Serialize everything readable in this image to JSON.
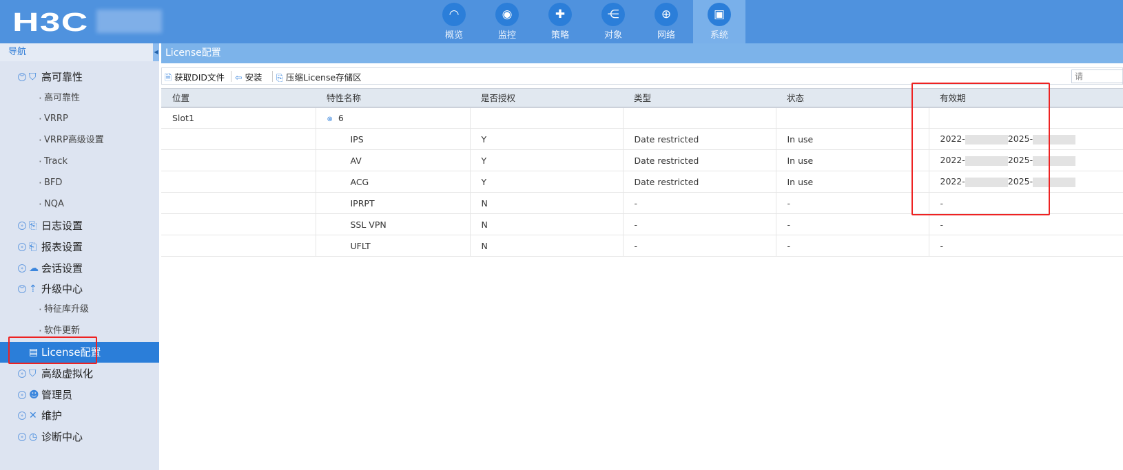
{
  "header": {
    "logo": "H3C",
    "tabs": [
      {
        "label": "概览",
        "icon": "gauge-icon",
        "glyph": "◠"
      },
      {
        "label": "监控",
        "icon": "webcam-icon",
        "glyph": "◉"
      },
      {
        "label": "策略",
        "icon": "shield-icon",
        "glyph": "✚"
      },
      {
        "label": "对象",
        "icon": "share-icon",
        "glyph": "⋲"
      },
      {
        "label": "网络",
        "icon": "globe-icon",
        "glyph": "⊕"
      },
      {
        "label": "系统",
        "icon": "monitor-icon",
        "glyph": "▣"
      }
    ],
    "active": "系统"
  },
  "sidebar": {
    "title": "导航",
    "items": [
      {
        "label": "高可靠性",
        "icon": "⛉"
      },
      {
        "label": "高可靠性"
      },
      {
        "label": "VRRP"
      },
      {
        "label": "VRRP高级设置"
      },
      {
        "label": "Track"
      },
      {
        "label": "BFD"
      },
      {
        "label": "NQA"
      },
      {
        "label": "日志设置",
        "icon": "⎘"
      },
      {
        "label": "报表设置",
        "icon": "⎗"
      },
      {
        "label": "会话设置",
        "icon": "☁"
      },
      {
        "label": "升级中心",
        "icon": "⇡"
      },
      {
        "label": "特征库升级"
      },
      {
        "label": "软件更新"
      },
      {
        "label": "License配置",
        "icon": "▤"
      },
      {
        "label": "高级虚拟化",
        "icon": "⛉"
      },
      {
        "label": "管理员",
        "icon": "☻"
      },
      {
        "label": "维护",
        "icon": "✕"
      },
      {
        "label": "诊断中心",
        "icon": "◷"
      }
    ]
  },
  "page": {
    "title": "License配置"
  },
  "toolbar": {
    "get_did": "获取DID文件",
    "install": "安装",
    "compress": "压缩License存储区",
    "search_placeholder": "请"
  },
  "table": {
    "headers": [
      "位置",
      "特性名称",
      "是否授权",
      "类型",
      "状态",
      "有效期"
    ],
    "group": {
      "slot": "Slot1",
      "count": "6"
    },
    "rows": [
      {
        "name": "IPS",
        "auth": "Y",
        "type": "Date restricted",
        "status": "In use",
        "validity_start": "2022-",
        "validity_end": "2025-"
      },
      {
        "name": "AV",
        "auth": "Y",
        "type": "Date restricted",
        "status": "In use",
        "validity_start": "2022-",
        "validity_end": "2025-"
      },
      {
        "name": "ACG",
        "auth": "Y",
        "type": "Date restricted",
        "status": "In use",
        "validity_start": "2022-",
        "validity_end": "2025-"
      },
      {
        "name": "IPRPT",
        "auth": "N",
        "type": "-",
        "status": "-",
        "validity": "-"
      },
      {
        "name": "SSL VPN",
        "auth": "N",
        "type": "-",
        "status": "-",
        "validity": "-"
      },
      {
        "name": "UFLT",
        "auth": "N",
        "type": "-",
        "status": "-",
        "validity": "-"
      }
    ]
  }
}
